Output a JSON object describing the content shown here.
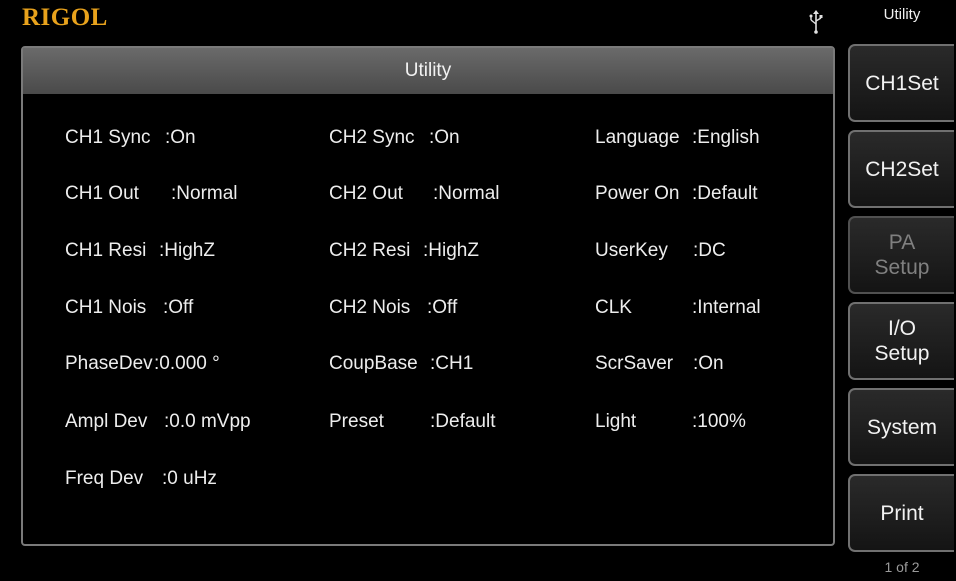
{
  "header": {
    "logo": "RIGOL",
    "title": "Utility"
  },
  "panel": {
    "title": "Utility"
  },
  "settings": {
    "col1": [
      {
        "label": "CH1 Sync",
        "value": ":On"
      },
      {
        "label": "CH1 Out",
        "value": ":Normal"
      },
      {
        "label": "CH1 Resi",
        "value": ":HighZ"
      },
      {
        "label": "CH1 Nois",
        "value": ":Off"
      },
      {
        "label": "PhaseDev",
        "value": ":0.000 °"
      },
      {
        "label": "Ampl Dev",
        "value": ":0.0 mVpp"
      },
      {
        "label": "Freq Dev",
        "value": ":0 uHz"
      }
    ],
    "col2": [
      {
        "label": "CH2 Sync",
        "value": ":On"
      },
      {
        "label": "CH2 Out",
        "value": ":Normal"
      },
      {
        "label": "CH2 Resi",
        "value": ":HighZ"
      },
      {
        "label": "CH2 Nois",
        "value": ":Off"
      },
      {
        "label": "CoupBase",
        "value": ":CH1"
      },
      {
        "label": "Preset",
        "value": ":Default"
      }
    ],
    "col3": [
      {
        "label": "Language",
        "value": ":English"
      },
      {
        "label": "Power On",
        "value": ":Default"
      },
      {
        "label": "UserKey",
        "value": ":DC"
      },
      {
        "label": "CLK",
        "value": ":Internal"
      },
      {
        "label": "ScrSaver",
        "value": ":On"
      },
      {
        "label": "Light",
        "value": ":100%"
      }
    ]
  },
  "softkeys": [
    {
      "line1": "CH1Set",
      "line2": "",
      "enabled": true
    },
    {
      "line1": "CH2Set",
      "line2": "",
      "enabled": true
    },
    {
      "line1": "PA",
      "line2": "Setup",
      "enabled": false
    },
    {
      "line1": "I/O",
      "line2": "Setup",
      "enabled": true
    },
    {
      "line1": "System",
      "line2": "",
      "enabled": true
    },
    {
      "line1": "Print",
      "line2": "",
      "enabled": true
    }
  ],
  "page_indicator": "1 of 2"
}
